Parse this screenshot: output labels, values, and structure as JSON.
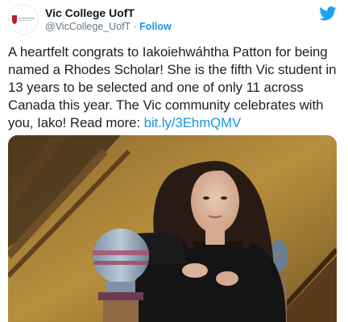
{
  "account": {
    "name": "Vic College UofT",
    "handle": "@VicCollege_UofT",
    "separator": "·",
    "follow_label": "Follow",
    "avatar_icon": "victoria-college-crest-icon",
    "logo_icon": "twitter-bird-icon"
  },
  "tweet": {
    "text": "A heartfelt congrats to Iakoiehwáhtha Patton for being named a Rhodes Scholar! She is the fifth Vic student in 13 years to be selected and one of only 11 across Canada this year. The Vic community celebrates with you, Iako! Read more: ",
    "link_text": "bit.ly/3EhmQMV"
  },
  "colors": {
    "link": "#1b95e0",
    "twitter_blue": "#1da1f2",
    "text": "#1c2022",
    "secondary": "#657786",
    "crest_red": "#b22234"
  }
}
